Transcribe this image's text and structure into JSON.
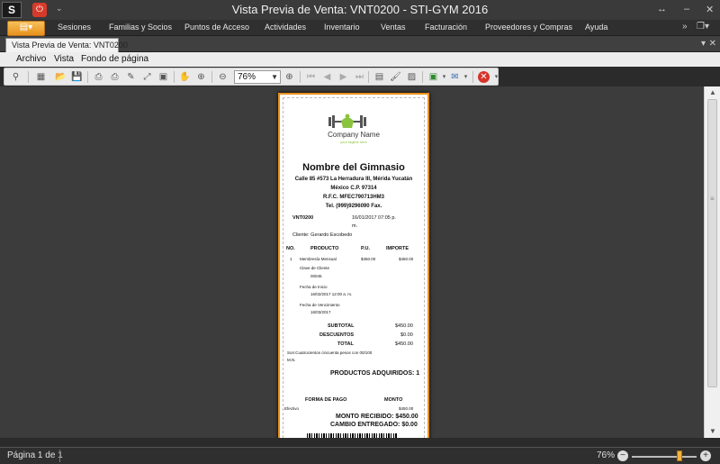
{
  "window": {
    "title": "Vista Previa de Venta: VNT0200 - STI-GYM 2016",
    "app_logo": "S",
    "controls": {
      "ribbon_toggle": "↔",
      "minimize": "–",
      "close": "✕"
    }
  },
  "ribbon": {
    "tabs": [
      "Sesiones",
      "Familias y Socios",
      "Puntos de Acceso",
      "Actividades",
      "Inventario",
      "Ventas",
      "Facturación",
      "Proveedores y Compras",
      "Ayuda"
    ],
    "right_icons": [
      "chevron-double-down",
      "windows"
    ]
  },
  "doc_tab": {
    "label": "Vista Previa de Venta: VNT0200"
  },
  "preview_menu": {
    "items": [
      "Archivo",
      "Vista",
      "Fondo de página"
    ]
  },
  "toolbar": {
    "zoom": "76%"
  },
  "receipt": {
    "company_name": "Company Name",
    "company_tagline": "your tagline here",
    "gym_name": "Nombre del Gimnasio",
    "address_1": "Calle 85 #573  La Herradura III, Mérida Yucatán",
    "address_2": "México C.P. 97314",
    "rfc": "R.F.C. MFEC790713HM3",
    "phone": "Tel. (999)9296090  Fax.",
    "sale_id": "VNT0200",
    "date_1": "16/01/2017 07:05 p.",
    "date_2": "m.",
    "client": "Cliente: Gerardo Escobedo",
    "col_no": "NO.",
    "col_product": "PRODUCTO",
    "col_pu": "P.U.",
    "col_amount": "IMPORTE",
    "item_no": "1",
    "item_name": "Membresía Mensual",
    "item_pu": "$450.00",
    "item_amount": "$450.00",
    "client_key_label": "Clave de Cliente",
    "client_key": "00045",
    "start_label": "Fecha de Inicio",
    "start_date": "16/02/2017 12:00 a. m.",
    "due_label": "Fecha de Vencimiento",
    "due_date": "16/03/2017",
    "subtotal_label": "SUBTOTAL",
    "subtotal": "$450.00",
    "discounts_label": "DESCUENTOS",
    "discounts": "$0.00",
    "total_label": "TOTAL",
    "total": "$450.00",
    "words_1": "Son:Cuatrocientos    cincuenta    pesos    con    00/100",
    "words_2": "M.N.",
    "products_count": "PRODUCTOS ADQUIRIDOS: 1",
    "payment_label": "FORMA DE PAGO",
    "amount_label": "MONTO",
    "payment_method": "Efectivo",
    "payment_amount": "$450.00",
    "received": "MONTO RECIBIDO: $450.00",
    "change": "CAMBIO ENTREGADO:  $0.00"
  },
  "status": {
    "page": "Página 1 de 1",
    "zoom": "76%",
    "zoom_level_percent": 76
  },
  "colors": {
    "accent": "#e8911c",
    "logo_green": "#8ac43f",
    "logo_gray": "#555555"
  }
}
